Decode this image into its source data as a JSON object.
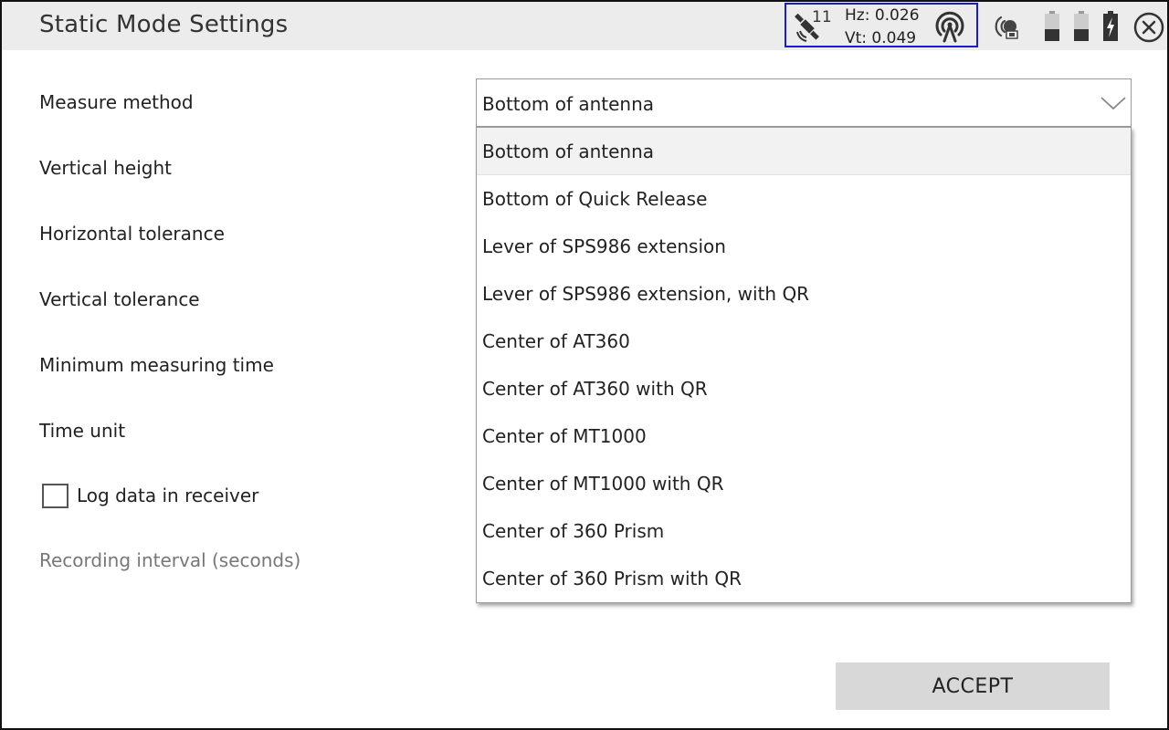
{
  "window": {
    "title": "Static Mode Settings"
  },
  "status": {
    "satellite_count": "11",
    "hz": "Hz: 0.026",
    "vt": "Vt: 0.049",
    "highlight_color": "#1a1ad0",
    "icons": [
      "satellite-icon",
      "antenna-icon",
      "radio-icon",
      "battery-icon",
      "battery-icon",
      "battery-charging-icon",
      "close-icon"
    ]
  },
  "form": {
    "labels": {
      "measure_method": "Measure method",
      "vertical_height": "Vertical height",
      "horizontal_tolerance": "Horizontal tolerance",
      "vertical_tolerance": "Vertical tolerance",
      "minimum_measuring_time": "Minimum measuring time",
      "time_unit": "Time unit",
      "log_data": "Log data in receiver",
      "recording_interval": "Recording interval (seconds)"
    },
    "log_data_checked": false,
    "measure_method": {
      "value": "Bottom of antenna",
      "options": [
        "Bottom of antenna",
        "Bottom of Quick Release",
        "Lever of SPS986 extension",
        "Lever of SPS986 extension, with QR",
        "Center of AT360",
        "Center of AT360 with QR",
        "Center of MT1000",
        "Center of MT1000 with QR",
        "Center of 360 Prism",
        "Center of 360 Prism with QR"
      ]
    }
  },
  "actions": {
    "accept": "ACCEPT"
  }
}
